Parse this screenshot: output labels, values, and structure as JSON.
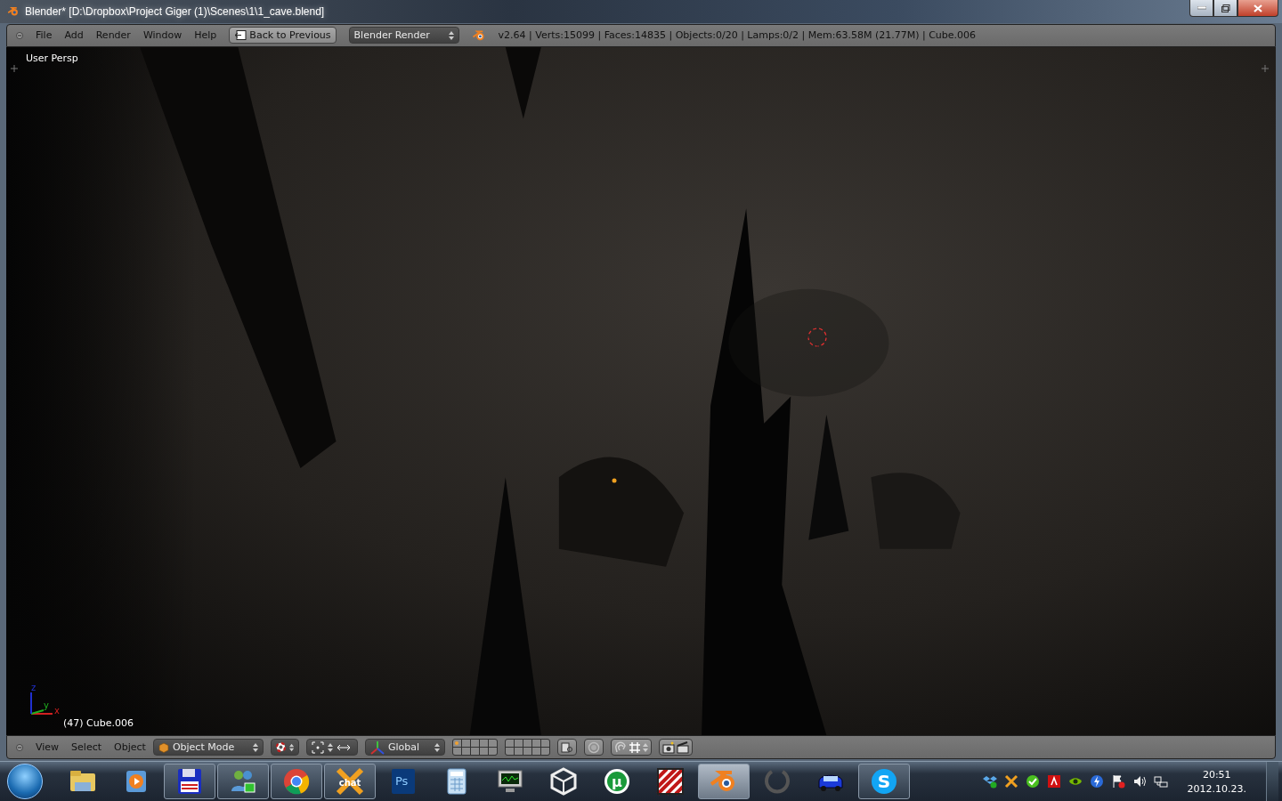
{
  "window": {
    "title": "Blender* [D:\\Dropbox\\Project Giger (1)\\Scenes\\1\\1_cave.blend]"
  },
  "top_header": {
    "menus": [
      "File",
      "Add",
      "Render",
      "Window",
      "Help"
    ],
    "back_button": "Back to Previous",
    "render_engine": "Blender Render",
    "stats": "v2.64 | Verts:15099 | Faces:14835 | Objects:0/20 | Lamps:0/2 | Mem:63.58M (21.77M) | Cube.006"
  },
  "viewport": {
    "view_label": "User Persp",
    "axes": [
      {
        "kind": "x",
        "label": "x"
      },
      {
        "kind": "y",
        "label": "y"
      },
      {
        "kind": "z",
        "label": "z"
      }
    ],
    "object_label": "(47) Cube.006"
  },
  "bottom_header": {
    "menus": [
      "View",
      "Select",
      "Object"
    ],
    "mode": "Object Mode",
    "orientation": "Global",
    "layers": [
      {
        "has_active": true
      },
      {
        "has_active": false
      },
      {
        "has_active": false
      },
      {
        "has_active": false
      },
      {
        "has_active": false
      },
      {
        "has_active": false
      },
      {
        "has_active": false
      },
      {
        "has_active": false
      },
      {
        "has_active": false
      },
      {
        "has_active": false
      },
      {
        "has_active": false
      },
      {
        "has_active": false
      },
      {
        "has_active": false
      },
      {
        "has_active": false
      },
      {
        "has_active": false
      },
      {
        "has_active": false
      },
      {
        "has_active": false
      },
      {
        "has_active": false
      },
      {
        "has_active": false
      },
      {
        "has_active": false
      }
    ]
  },
  "taskbar": {
    "items": [
      {
        "kind": "folder",
        "running": false,
        "selected": false
      },
      {
        "kind": "player",
        "running": false,
        "selected": false
      },
      {
        "kind": "floppy",
        "running": true,
        "selected": false
      },
      {
        "kind": "messenger",
        "running": true,
        "selected": false
      },
      {
        "kind": "chrome",
        "running": true,
        "selected": false
      },
      {
        "kind": "chat",
        "label": "chat",
        "running": true,
        "selected": false
      },
      {
        "kind": "photoshop",
        "label": "Ps",
        "running": false,
        "selected": false
      },
      {
        "kind": "calculator",
        "running": false,
        "selected": false
      },
      {
        "kind": "monitor",
        "running": false,
        "selected": false
      },
      {
        "kind": "unity",
        "running": false,
        "selected": false
      },
      {
        "kind": "torrent",
        "label": "µ",
        "running": false,
        "selected": false
      },
      {
        "kind": "stripes",
        "running": false,
        "selected": false
      },
      {
        "kind": "blender",
        "running": true,
        "selected": true
      },
      {
        "kind": "ring",
        "running": false,
        "selected": false
      },
      {
        "kind": "car",
        "running": false,
        "selected": false
      },
      {
        "kind": "skype",
        "label": "S",
        "running": true,
        "selected": false
      }
    ],
    "tray": [
      {
        "kind": "dropbox"
      },
      {
        "kind": "cross"
      },
      {
        "kind": "check"
      },
      {
        "kind": "adobe"
      },
      {
        "kind": "nvidia"
      },
      {
        "kind": "bolt"
      },
      {
        "kind": "flag"
      },
      {
        "kind": "speaker"
      },
      {
        "kind": "network"
      }
    ],
    "clock": {
      "time": "20:51",
      "date": "2012.10.23."
    }
  }
}
